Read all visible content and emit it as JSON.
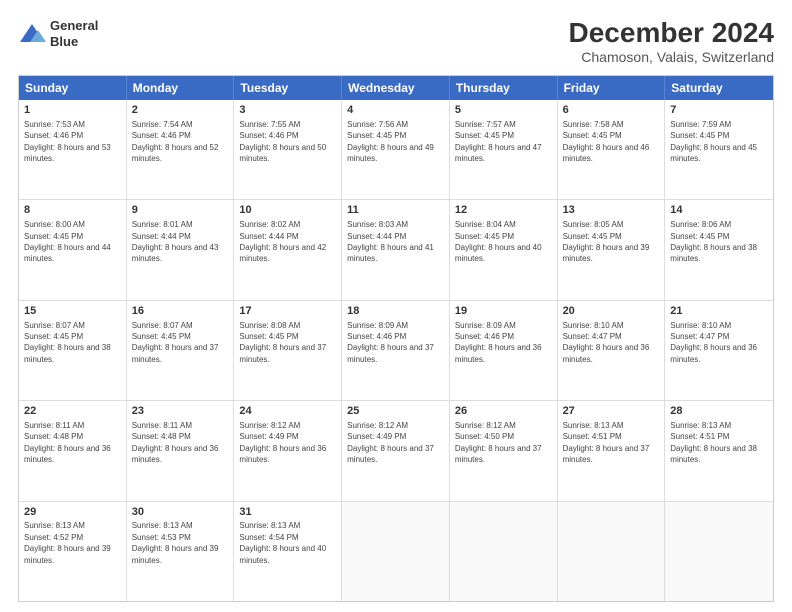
{
  "header": {
    "logo_line1": "General",
    "logo_line2": "Blue",
    "main_title": "December 2024",
    "subtitle": "Chamoson, Valais, Switzerland"
  },
  "weekdays": [
    "Sunday",
    "Monday",
    "Tuesday",
    "Wednesday",
    "Thursday",
    "Friday",
    "Saturday"
  ],
  "weeks": [
    [
      {
        "day": "1",
        "sunrise": "7:53 AM",
        "sunset": "4:46 PM",
        "daylight": "8 hours and 53 minutes."
      },
      {
        "day": "2",
        "sunrise": "7:54 AM",
        "sunset": "4:46 PM",
        "daylight": "8 hours and 52 minutes."
      },
      {
        "day": "3",
        "sunrise": "7:55 AM",
        "sunset": "4:46 PM",
        "daylight": "8 hours and 50 minutes."
      },
      {
        "day": "4",
        "sunrise": "7:56 AM",
        "sunset": "4:45 PM",
        "daylight": "8 hours and 49 minutes."
      },
      {
        "day": "5",
        "sunrise": "7:57 AM",
        "sunset": "4:45 PM",
        "daylight": "8 hours and 47 minutes."
      },
      {
        "day": "6",
        "sunrise": "7:58 AM",
        "sunset": "4:45 PM",
        "daylight": "8 hours and 46 minutes."
      },
      {
        "day": "7",
        "sunrise": "7:59 AM",
        "sunset": "4:45 PM",
        "daylight": "8 hours and 45 minutes."
      }
    ],
    [
      {
        "day": "8",
        "sunrise": "8:00 AM",
        "sunset": "4:45 PM",
        "daylight": "8 hours and 44 minutes."
      },
      {
        "day": "9",
        "sunrise": "8:01 AM",
        "sunset": "4:44 PM",
        "daylight": "8 hours and 43 minutes."
      },
      {
        "day": "10",
        "sunrise": "8:02 AM",
        "sunset": "4:44 PM",
        "daylight": "8 hours and 42 minutes."
      },
      {
        "day": "11",
        "sunrise": "8:03 AM",
        "sunset": "4:44 PM",
        "daylight": "8 hours and 41 minutes."
      },
      {
        "day": "12",
        "sunrise": "8:04 AM",
        "sunset": "4:45 PM",
        "daylight": "8 hours and 40 minutes."
      },
      {
        "day": "13",
        "sunrise": "8:05 AM",
        "sunset": "4:45 PM",
        "daylight": "8 hours and 39 minutes."
      },
      {
        "day": "14",
        "sunrise": "8:06 AM",
        "sunset": "4:45 PM",
        "daylight": "8 hours and 38 minutes."
      }
    ],
    [
      {
        "day": "15",
        "sunrise": "8:07 AM",
        "sunset": "4:45 PM",
        "daylight": "8 hours and 38 minutes."
      },
      {
        "day": "16",
        "sunrise": "8:07 AM",
        "sunset": "4:45 PM",
        "daylight": "8 hours and 37 minutes."
      },
      {
        "day": "17",
        "sunrise": "8:08 AM",
        "sunset": "4:45 PM",
        "daylight": "8 hours and 37 minutes."
      },
      {
        "day": "18",
        "sunrise": "8:09 AM",
        "sunset": "4:46 PM",
        "daylight": "8 hours and 37 minutes."
      },
      {
        "day": "19",
        "sunrise": "8:09 AM",
        "sunset": "4:46 PM",
        "daylight": "8 hours and 36 minutes."
      },
      {
        "day": "20",
        "sunrise": "8:10 AM",
        "sunset": "4:47 PM",
        "daylight": "8 hours and 36 minutes."
      },
      {
        "day": "21",
        "sunrise": "8:10 AM",
        "sunset": "4:47 PM",
        "daylight": "8 hours and 36 minutes."
      }
    ],
    [
      {
        "day": "22",
        "sunrise": "8:11 AM",
        "sunset": "4:48 PM",
        "daylight": "8 hours and 36 minutes."
      },
      {
        "day": "23",
        "sunrise": "8:11 AM",
        "sunset": "4:48 PM",
        "daylight": "8 hours and 36 minutes."
      },
      {
        "day": "24",
        "sunrise": "8:12 AM",
        "sunset": "4:49 PM",
        "daylight": "8 hours and 36 minutes."
      },
      {
        "day": "25",
        "sunrise": "8:12 AM",
        "sunset": "4:49 PM",
        "daylight": "8 hours and 37 minutes."
      },
      {
        "day": "26",
        "sunrise": "8:12 AM",
        "sunset": "4:50 PM",
        "daylight": "8 hours and 37 minutes."
      },
      {
        "day": "27",
        "sunrise": "8:13 AM",
        "sunset": "4:51 PM",
        "daylight": "8 hours and 37 minutes."
      },
      {
        "day": "28",
        "sunrise": "8:13 AM",
        "sunset": "4:51 PM",
        "daylight": "8 hours and 38 minutes."
      }
    ],
    [
      {
        "day": "29",
        "sunrise": "8:13 AM",
        "sunset": "4:52 PM",
        "daylight": "8 hours and 39 minutes."
      },
      {
        "day": "30",
        "sunrise": "8:13 AM",
        "sunset": "4:53 PM",
        "daylight": "8 hours and 39 minutes."
      },
      {
        "day": "31",
        "sunrise": "8:13 AM",
        "sunset": "4:54 PM",
        "daylight": "8 hours and 40 minutes."
      },
      null,
      null,
      null,
      null
    ]
  ]
}
